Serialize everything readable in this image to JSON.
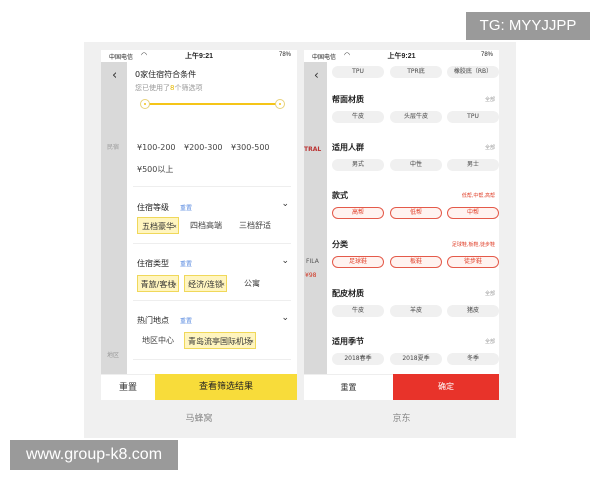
{
  "watermarks": {
    "tg": "TG: MYYJJPP",
    "site": "www.group-k8.com"
  },
  "status": {
    "carrier": "中国电信",
    "time": "上午9:21",
    "battery": "78%"
  },
  "mafengwo": {
    "caption": "马蜂窝",
    "dim_texts": [
      "民宿",
      "地区"
    ],
    "title": "0家住宿符合条件",
    "subtitle_pre": "您已使用了",
    "subtitle_count": "8",
    "subtitle_post": "个筛选项",
    "prices": [
      "¥100-200",
      "¥200-300",
      "¥300-500",
      "¥500以上"
    ],
    "sections": [
      {
        "title": "住宿等级",
        "reset": "重置",
        "tags": [
          "五档豪华",
          "四档高端",
          "三档舒适"
        ]
      },
      {
        "title": "住宿类型",
        "reset": "重置",
        "tags": [
          "青旅/客栈",
          "经济/连锁",
          "公寓"
        ]
      },
      {
        "title": "热门地点",
        "reset": "重置",
        "tags": [
          "地区中心",
          "青岛流亭国际机场"
        ]
      }
    ],
    "buttons": {
      "reset": "重置",
      "submit": "查看筛选结果"
    }
  },
  "jd": {
    "caption": "京东",
    "dim_texts": [
      "TRAL",
      "FILA",
      "¥98"
    ],
    "top_pills": [
      "TPU",
      "TPR底",
      "橡胶底（RB）"
    ],
    "sections": [
      {
        "title": "帮面材质",
        "right": "全部",
        "pills": [
          "牛皮",
          "头层牛皮",
          "TPU"
        ],
        "selected": false
      },
      {
        "title": "适用人群",
        "right": "全部",
        "pills": [
          "男式",
          "中性",
          "男士"
        ],
        "selected": false
      },
      {
        "title": "款式",
        "right": "低帮,中帮,高帮",
        "pills": [
          "高帮",
          "低帮",
          "中帮"
        ],
        "selected": true
      },
      {
        "title": "分类",
        "right": "足球鞋,板鞋,徒步鞋",
        "pills": [
          "足球鞋",
          "板鞋",
          "徒步鞋"
        ],
        "selected": true
      },
      {
        "title": "配皮材质",
        "right": "全部",
        "pills": [
          "牛皮",
          "羊皮",
          "猪皮"
        ],
        "selected": false
      },
      {
        "title": "适用季节",
        "right": "全部",
        "pills": [
          "2018春季",
          "2018夏季",
          "冬季"
        ],
        "selected": false
      }
    ],
    "buttons": {
      "reset": "重置",
      "confirm": "确定"
    }
  }
}
